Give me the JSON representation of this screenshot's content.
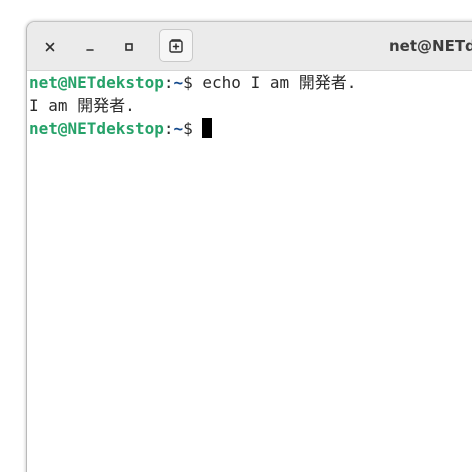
{
  "window": {
    "title": "net@NETdekstop: ~"
  },
  "titlebar": {
    "close_icon": "close-icon",
    "minimize_icon": "minimize-icon",
    "maximize_icon": "maximize-icon",
    "new_tab_icon": "new-tab-icon"
  },
  "terminal": {
    "prompt_user": "net@NETdekstop",
    "prompt_sep": ":",
    "prompt_path": "~",
    "prompt_symbol": "$ ",
    "lines": [
      {
        "type": "command",
        "text": "echo I am 開発者."
      },
      {
        "type": "output",
        "text": "I am 開発者."
      },
      {
        "type": "command",
        "text": ""
      }
    ]
  },
  "colors": {
    "prompt_user": "#26a269",
    "prompt_path": "#12488b",
    "text": "#2b2b2b",
    "titlebar_bg": "#ebebeb"
  }
}
